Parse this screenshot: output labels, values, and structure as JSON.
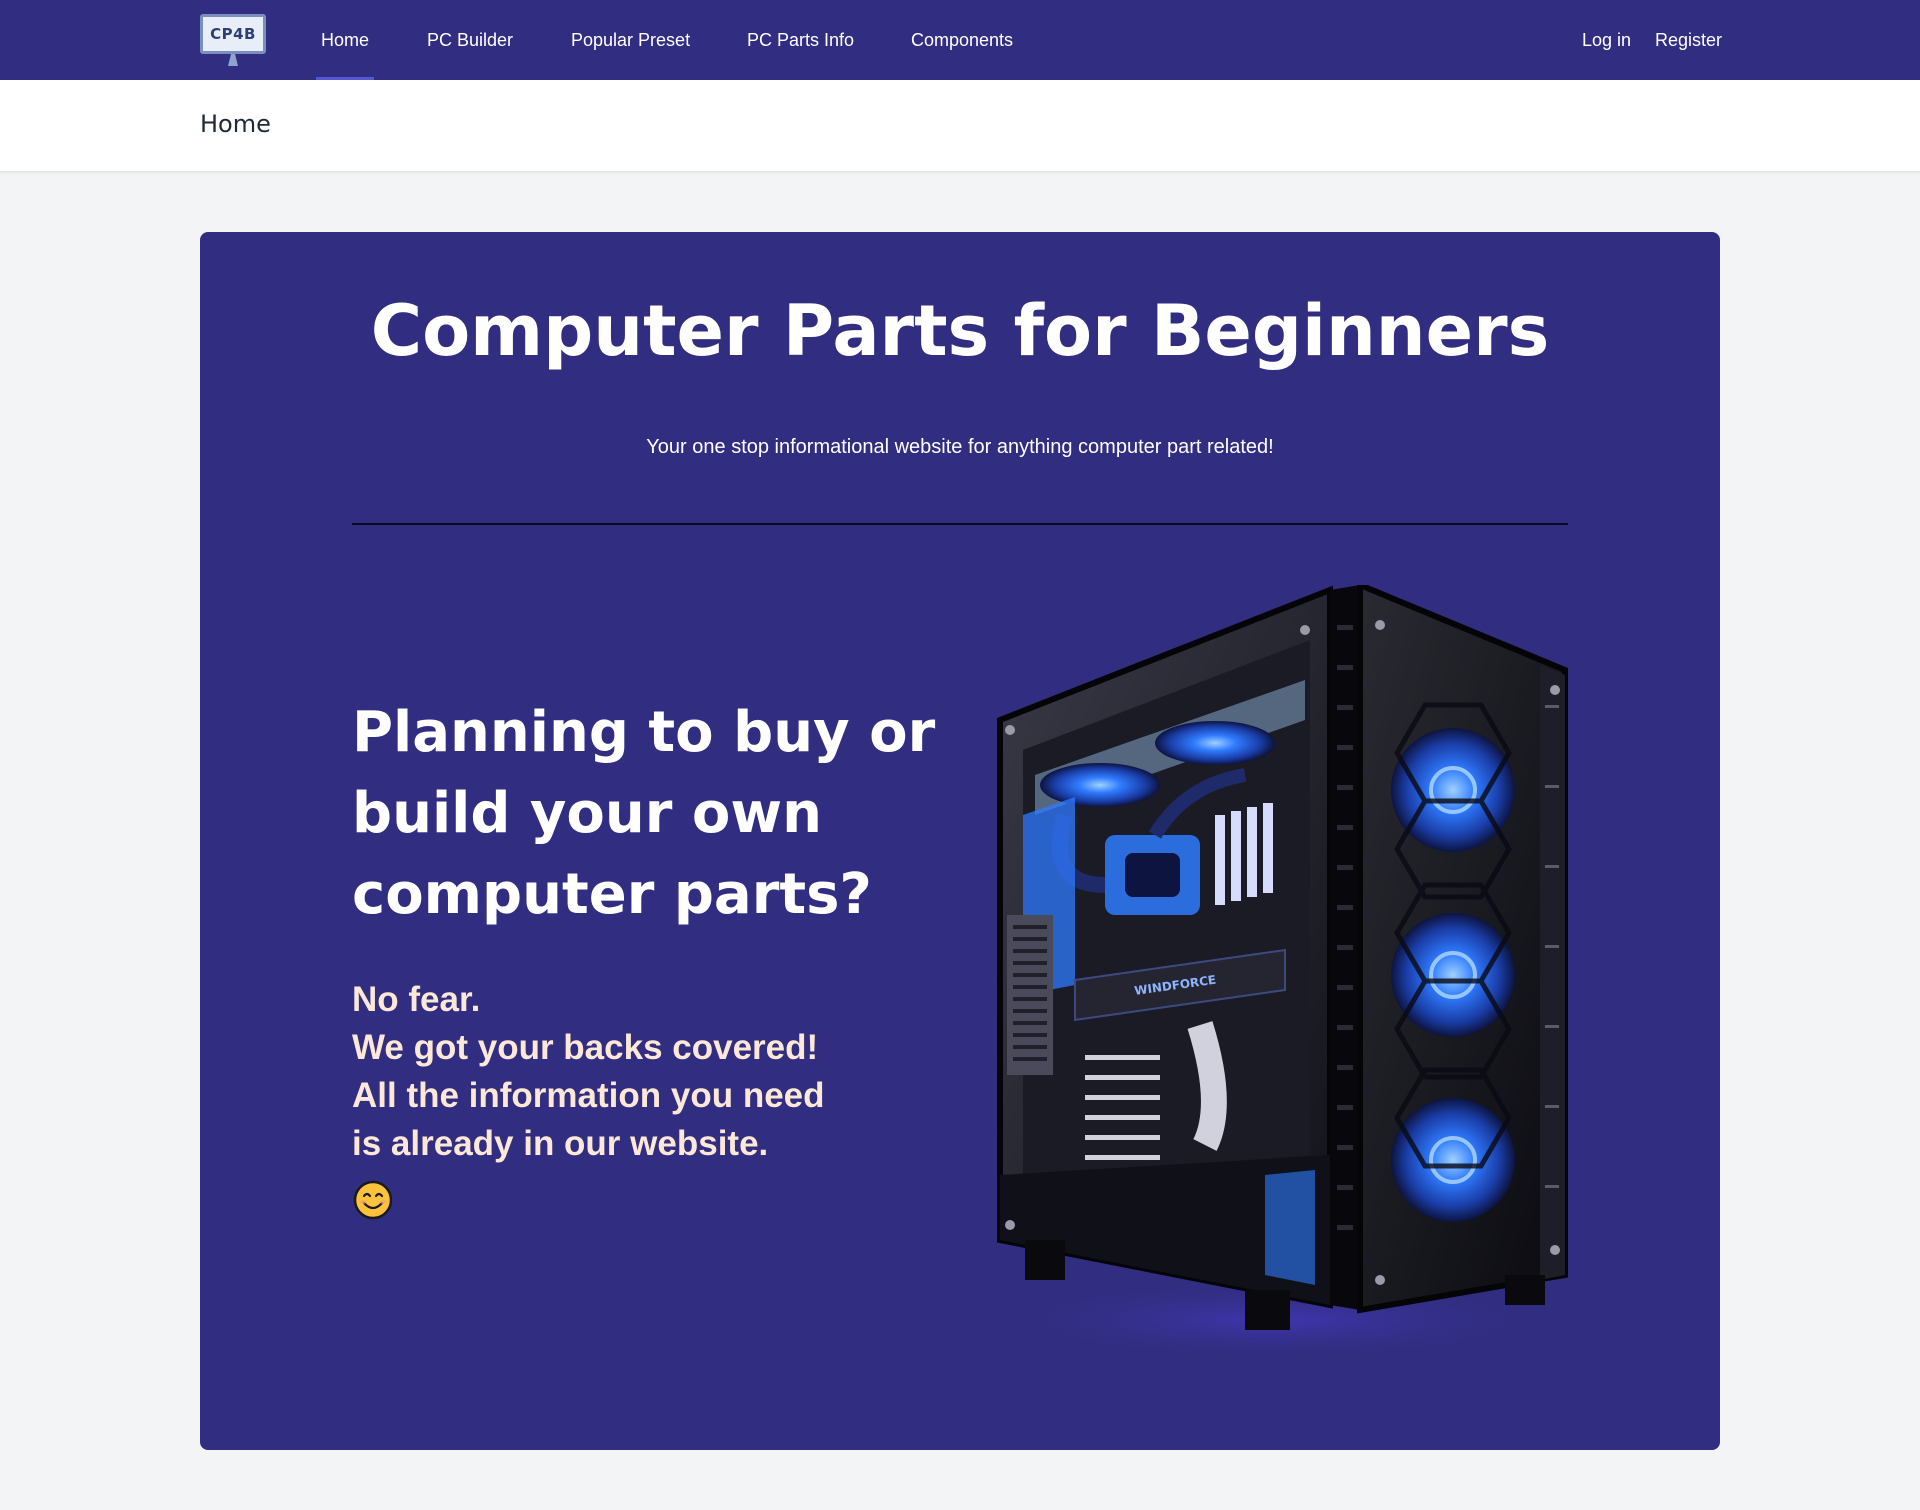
{
  "navbar": {
    "logo_text": "CP4B",
    "links": [
      {
        "label": "Home",
        "active": true
      },
      {
        "label": "PC Builder",
        "active": false
      },
      {
        "label": "Popular Preset",
        "active": false
      },
      {
        "label": "PC Parts Info",
        "active": false
      },
      {
        "label": "Components",
        "active": false
      }
    ],
    "login_label": "Log in",
    "register_label": "Register"
  },
  "header": {
    "title": "Home"
  },
  "hero": {
    "title": "Computer Parts for Beginners",
    "subtitle": "Your one stop informational website for anything computer part related!",
    "headline": "Planning to buy or build your own computer parts?",
    "tagline_lines": [
      "No fear.",
      "We got your backs covered!",
      "All the information you need",
      "is already in our website."
    ],
    "emoji_icon": "smiling-face-icon",
    "image_icon": "pc-case-image"
  },
  "colors": {
    "nav_bg": "#312e81",
    "hero_bg": "#312e81",
    "page_bg": "#f3f4f6",
    "tagline": "#fde8d8",
    "accent_fan": "#2f7bff"
  }
}
